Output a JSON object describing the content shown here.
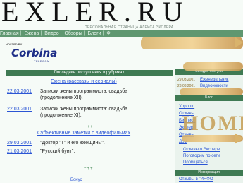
{
  "header": {
    "logo": "EXLER.RU",
    "tagline": "ПЕРСОНАЛЬНАЯ СТРАНИЦА АЛЕКСА ЭКСЛЕРА"
  },
  "nav": {
    "items": [
      "Главная",
      "Ежена",
      "Видео",
      "Обзоры",
      "Блоги",
      "Ф"
    ]
  },
  "sponsor": {
    "hosted_by": "HOSTED BY",
    "brand": "Corbina",
    "sub": "TELECOM"
  },
  "main": {
    "header": "Последние поступления в рубриках",
    "section1_title": "Ежена",
    "section1_rest": "(рассказы и сериалы)",
    "entries1": [
      {
        "date": "22.03.2001",
        "text_line1": "Записки жены программиста: свадьба",
        "text_line2": "(продолжение XII)."
      },
      {
        "date": "22.03.2001",
        "text_line1": "Записки жены программиста: свадьба",
        "text_line2": "(продолжение XI)."
      }
    ],
    "more1": "+++",
    "section2_title": "Субъективные заметки о видеофильмах",
    "entries2": [
      {
        "date": "29.03.2001",
        "text": "\"Доктор \"Т\" и его женщины\"."
      },
      {
        "date": "21.03.2001",
        "text": "\"Русский бунт\"."
      }
    ],
    "more2": "+++",
    "cut_bottom": "Бонус"
  },
  "right": {
    "header": "Сегодня поступи",
    "recent": [
      {
        "date": "29.03.2001",
        "text": "Еженедельник"
      },
      {
        "date": "23.03.2001",
        "text": "Видеоновости"
      }
    ],
    "header2": "Блог",
    "list": [
      "Хорошо",
      "Отзывы",
      "Библиот",
      "Экслер",
      "Отзывы",
      "Дом"
    ],
    "links": [
      "Отзывы о Экслере",
      "Поговорим по сети",
      "Пообщаться"
    ],
    "header3": "Информация",
    "bottom_link": "Отзывы в \"ИНФО"
  },
  "decor": {
    "home_text": "HOME"
  }
}
